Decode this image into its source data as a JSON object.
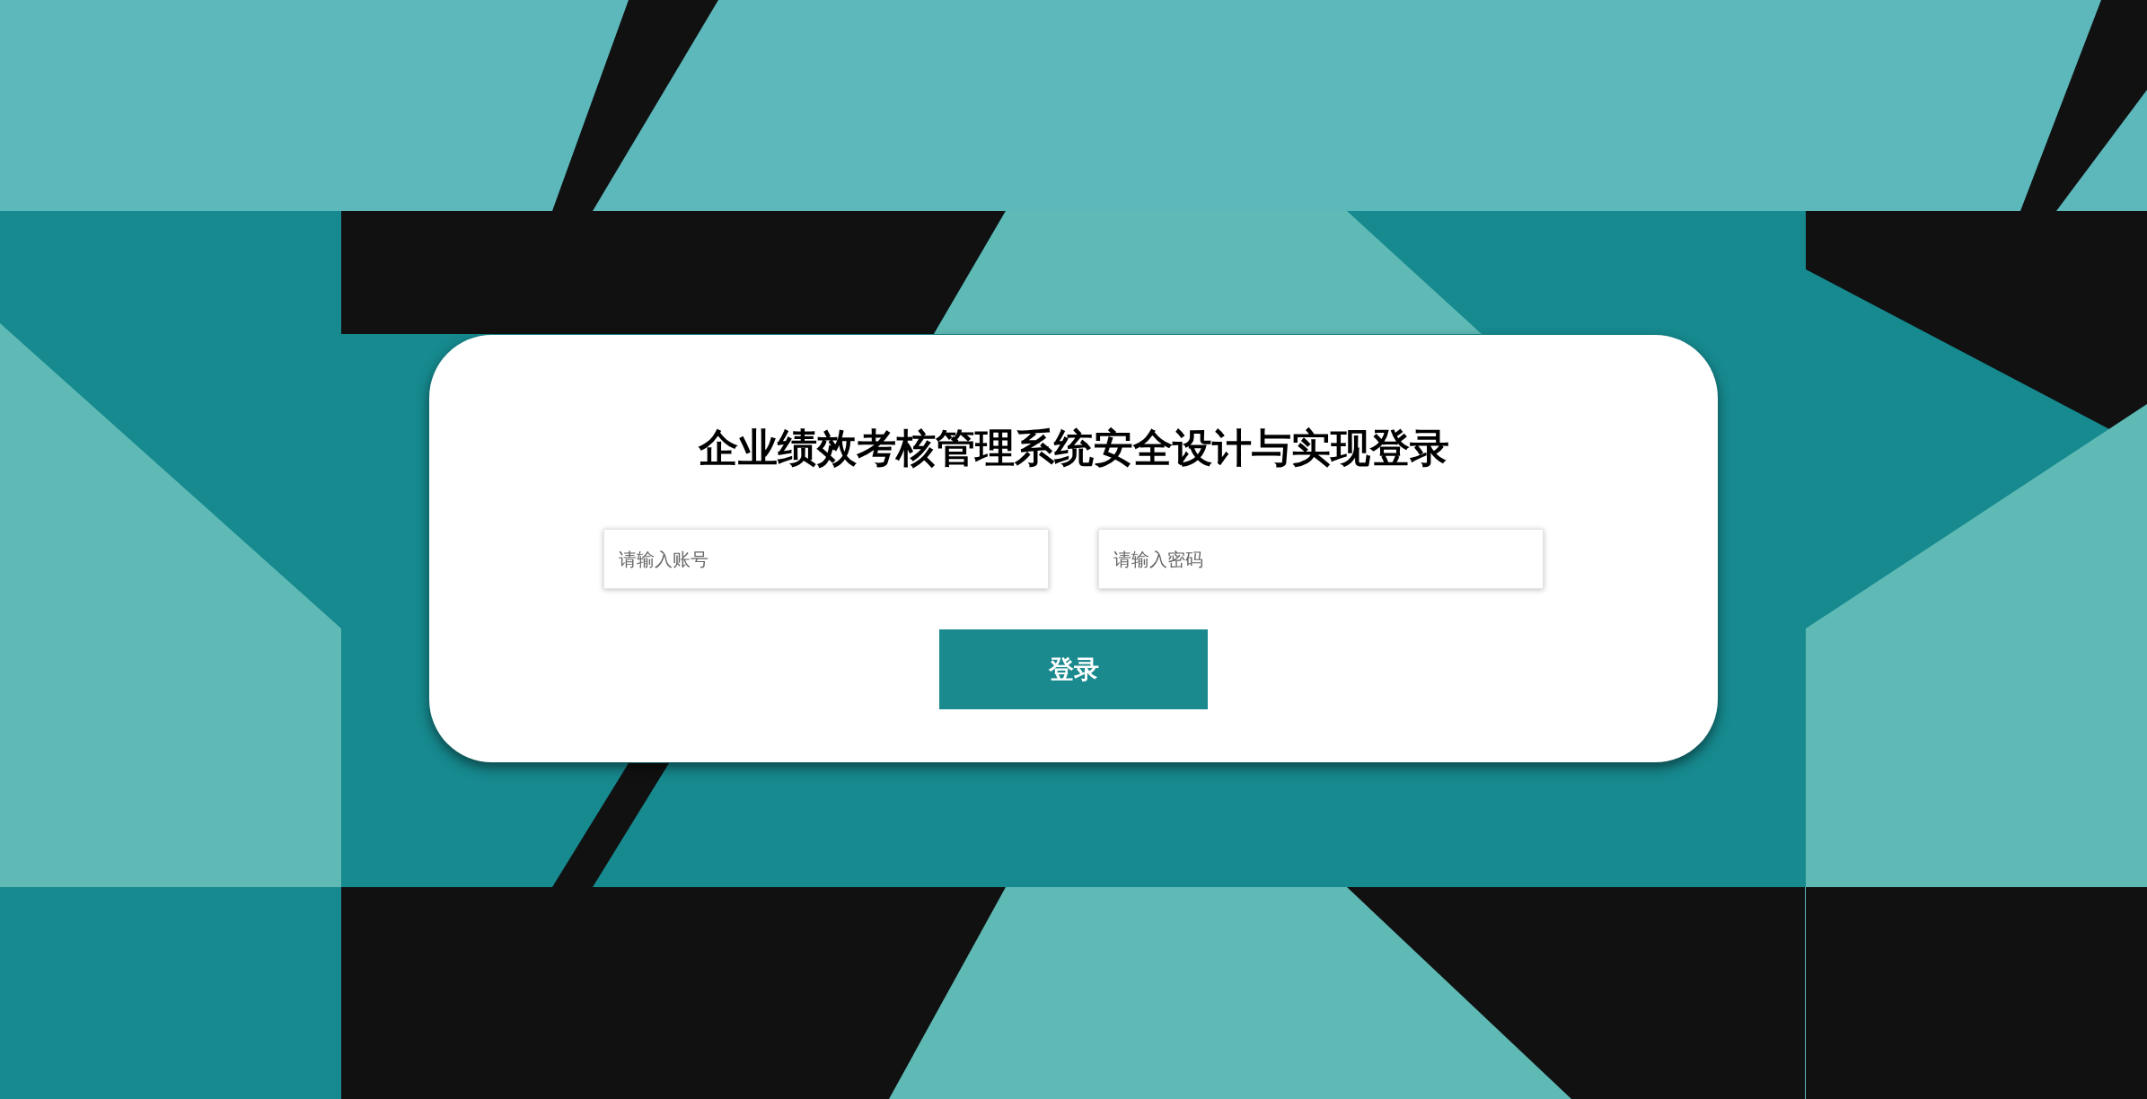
{
  "login": {
    "title": "企业绩效考核管理系统安全设计与实现登录",
    "fields": [
      {
        "placeholder": "请输入账号"
      },
      {
        "placeholder": "请输入密码"
      }
    ],
    "button": "登录"
  }
}
